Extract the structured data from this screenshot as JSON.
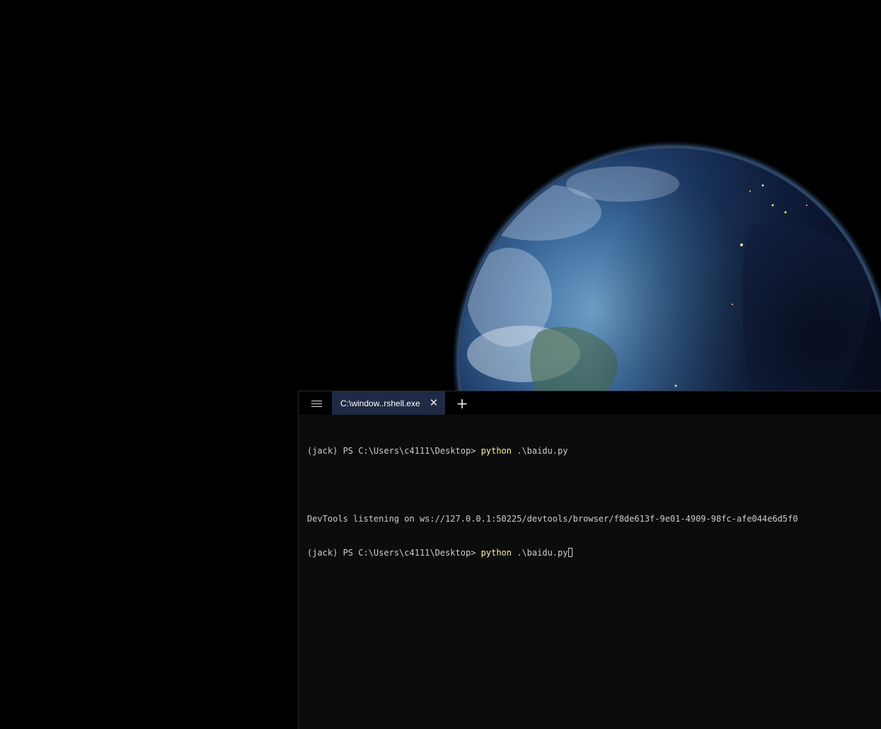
{
  "desktop": {
    "wallpaper": "earth-from-space"
  },
  "terminal": {
    "menu_icon": "hamburger-menu-icon",
    "tab_title": "C:\\window..rshell.exe",
    "tab_close_glyph": "✕",
    "new_tab_glyph": "+",
    "lines": [
      {
        "prompt": "(jack) PS C:\\Users\\c4111\\Desktop> ",
        "command": "python",
        "args": " .\\baidu.py"
      },
      {
        "text": ""
      },
      {
        "text": "DevTools listening on ws://127.0.0.1:50225/devtools/browser/f8de613f-9e01-4909-98fc-afe044e6d5f0"
      },
      {
        "prompt": "(jack) PS C:\\Users\\c4111\\Desktop> ",
        "command": "python",
        "args": " .\\baidu.py"
      }
    ]
  },
  "colors": {
    "terminal_bg": "#0c0c0c",
    "tab_active_bg": "#1f2a44",
    "command_yellow": "#f9f1a5",
    "text_gray": "#cccccc"
  }
}
